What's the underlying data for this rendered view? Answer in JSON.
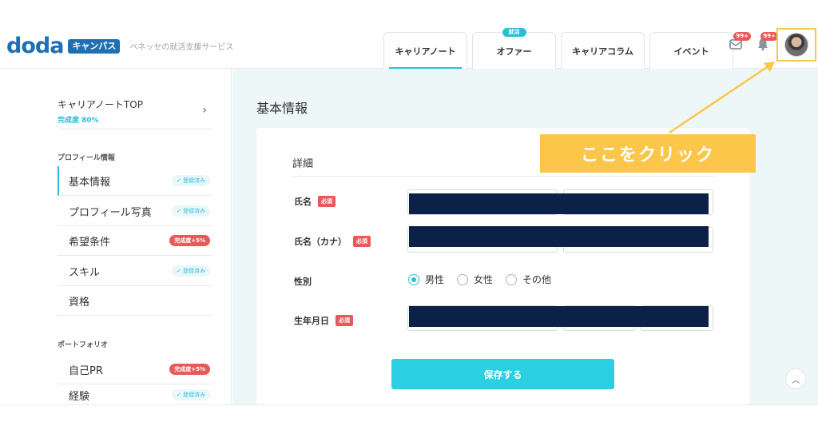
{
  "header": {
    "logo_text": "doda",
    "logo_badge": "キャンパス",
    "tagline": "ベネッセの就活支援サービス",
    "tabs": [
      {
        "label": "キャリアノート",
        "active": true,
        "badge": ""
      },
      {
        "label": "オファー",
        "active": false,
        "badge": "就活"
      },
      {
        "label": "キャリアコラム",
        "active": false,
        "badge": ""
      },
      {
        "label": "イベント",
        "active": false,
        "badge": ""
      }
    ],
    "message_count": "99+",
    "notification_count": "99+"
  },
  "sidebar": {
    "top": {
      "title": "キャリアノートTOP",
      "progress": "完成度 80%"
    },
    "section_profile": "プロフィール情報",
    "profile_items": [
      {
        "label": "基本情報",
        "status": "登録済み",
        "active": true
      },
      {
        "label": "プロフィール写真",
        "status": "登録済み"
      },
      {
        "label": "希望条件",
        "status": "完成度+5%"
      },
      {
        "label": "スキル",
        "status": "登録済み"
      },
      {
        "label": "資格",
        "status": ""
      }
    ],
    "section_portfolio": "ポートフォリオ",
    "portfolio_items": [
      {
        "label": "自己PR",
        "status": "完成度+5%"
      },
      {
        "label": "経験",
        "status": "登録済み"
      }
    ]
  },
  "main": {
    "page_title": "基本情報",
    "card_subtitle": "詳細",
    "required_label": "必須",
    "fields": {
      "name": "氏名",
      "kana": "氏名（カナ）",
      "gender": "性別",
      "birthday": "生年月日"
    },
    "gender_options": [
      {
        "label": "男性",
        "selected": true
      },
      {
        "label": "女性",
        "selected": false
      },
      {
        "label": "その他",
        "selected": false
      }
    ],
    "save_button": "保存する",
    "scroll_top_icon": "chevron-up-icon"
  },
  "annotation": {
    "callout_text": "ここをクリック",
    "color": "#fcc64a"
  },
  "colors": {
    "accent": "#2bbfd6",
    "brand": "#1e6fb5",
    "danger": "#e85a5a",
    "redaction": "#0b2147"
  }
}
